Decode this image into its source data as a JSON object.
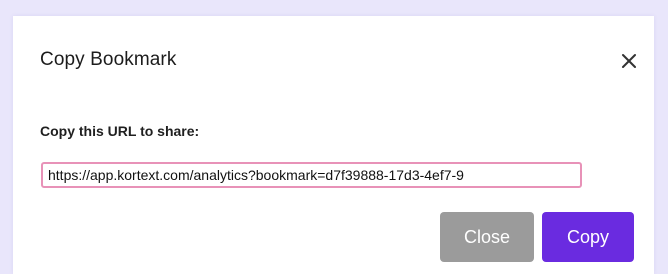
{
  "dialog": {
    "title": "Copy Bookmark",
    "close_icon": "close-icon",
    "field_label": "Copy this URL to share:",
    "url_value": "https://app.kortext.com/analytics?bookmark=d7f39888-17d3-4ef7-9",
    "buttons": {
      "close_label": "Close",
      "copy_label": "Copy"
    }
  },
  "colors": {
    "backdrop": "#e9e6fb",
    "dialog_background": "#ffffff",
    "input_border": "#e892b8",
    "close_button": "#9b9b9b",
    "copy_button": "#6a2be0"
  }
}
